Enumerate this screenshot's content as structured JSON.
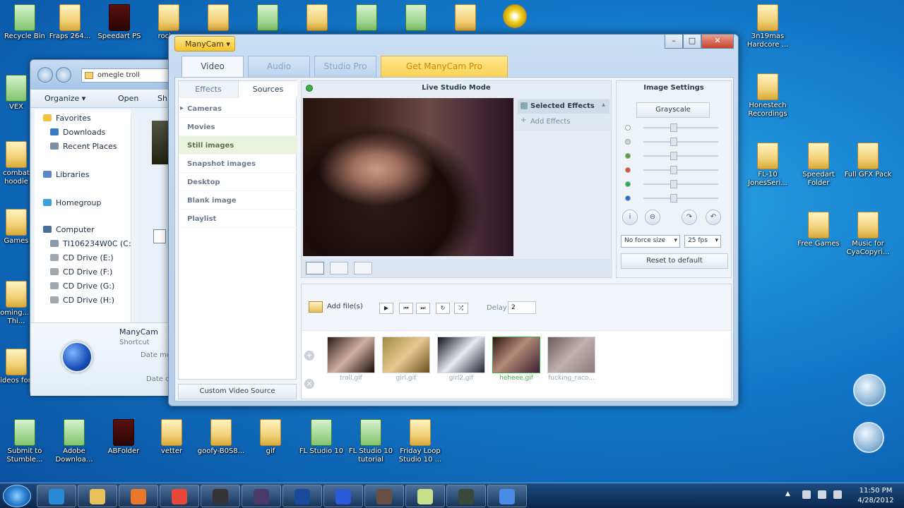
{
  "desktop": {
    "icons_top": [
      {
        "label": "Recycle Bin",
        "kind": "bin"
      },
      {
        "label": "Fraps 264...",
        "kind": "folder"
      },
      {
        "label": "Speedart PS",
        "kind": "dark"
      },
      {
        "label": "rock...",
        "kind": "folder"
      },
      {
        "label": "",
        "kind": "folder"
      },
      {
        "label": "",
        "kind": "app"
      },
      {
        "label": "",
        "kind": "folder"
      },
      {
        "label": "",
        "kind": "app"
      },
      {
        "label": "",
        "kind": "app"
      },
      {
        "label": "",
        "kind": "folder"
      },
      {
        "label": "",
        "kind": "disc"
      }
    ],
    "icons_left": [
      {
        "label": "VEX",
        "kind": "app"
      },
      {
        "label": "combat hoodie",
        "kind": "folder"
      },
      {
        "label": "Games",
        "kind": "folder"
      },
      {
        "label": "Coming... + Thi...",
        "kind": "folder"
      },
      {
        "label": "Videos for...",
        "kind": "folder"
      }
    ],
    "icons_right": [
      {
        "label": "3n19mas Hardcore ...",
        "kind": "folder"
      },
      {
        "label": "Honestech Recordings",
        "kind": "folder"
      },
      {
        "label": "FL-10 JonesSeri...",
        "kind": "folder"
      },
      {
        "label": "Speedart Folder",
        "kind": "folder"
      },
      {
        "label": "Full GFX Pack",
        "kind": "folder"
      },
      {
        "label": "Free Games",
        "kind": "folder"
      },
      {
        "label": "Music for CyaCopyri...",
        "kind": "folder"
      }
    ],
    "icons_bottom": [
      {
        "label": "Submit to Stumble...",
        "kind": "app"
      },
      {
        "label": "Adobe Downloa...",
        "kind": "app"
      },
      {
        "label": "ABFolder",
        "kind": "dark"
      },
      {
        "label": "vetter",
        "kind": "folder"
      },
      {
        "label": "goofy-B0S8...",
        "kind": "folder"
      },
      {
        "label": "gif",
        "kind": "folder"
      },
      {
        "label": "FL Studio 10",
        "kind": "app"
      },
      {
        "label": "FL Studio 10 tutorial",
        "kind": "app"
      },
      {
        "label": "Friday Loop Studio 10 ...",
        "kind": "folder"
      }
    ]
  },
  "explorer": {
    "address": "omegle troll",
    "toolbar": {
      "organize": "Organize ▾",
      "open": "Open",
      "share": "Sh"
    },
    "tree": [
      {
        "label": "Favorites",
        "icon": "star-icon",
        "color": "#f2c23a",
        "indent": 0
      },
      {
        "label": "Downloads",
        "icon": "downloads-icon",
        "color": "#3a79c8",
        "indent": 1
      },
      {
        "label": "Recent Places",
        "icon": "recent-places-icon",
        "color": "#7a8ea8",
        "indent": 1
      },
      {
        "label": "Libraries",
        "icon": "libraries-icon",
        "color": "#5a87c5",
        "indent": 0
      },
      {
        "label": "Homegroup",
        "icon": "homegroup-icon",
        "color": "#3aa0d8",
        "indent": 0
      },
      {
        "label": "Computer",
        "icon": "computer-icon",
        "color": "#4b6f9c",
        "indent": 0
      },
      {
        "label": "TI106234W0C (C:)",
        "icon": "drive-icon",
        "color": "#8899aa",
        "indent": 1
      },
      {
        "label": "CD Drive (E:)",
        "icon": "cd-drive-icon",
        "color": "#a0a8b0",
        "indent": 1
      },
      {
        "label": "CD Drive (F:)",
        "icon": "cd-drive-icon",
        "color": "#a0a8b0",
        "indent": 1
      },
      {
        "label": "CD Drive (G:)",
        "icon": "cd-drive-icon",
        "color": "#a0a8b0",
        "indent": 1
      },
      {
        "label": "CD Drive (H:)",
        "icon": "cd-drive-icon",
        "color": "#a0a8b0",
        "indent": 1
      }
    ],
    "detail": {
      "name": "ManyCam",
      "type": "Shortcut",
      "date_modified": "Date mo",
      "date_created": "Date c"
    }
  },
  "manycam": {
    "menu": "ManyCam ▾",
    "tabs": {
      "video": "Video",
      "audio": "Audio",
      "studio": "Studio Pro",
      "get": "Get ManyCam Pro"
    },
    "source_tabs": {
      "effects": "Effects",
      "sources": "Sources"
    },
    "sources": [
      "Cameras",
      "Movies",
      "Still images",
      "Snapshot images",
      "Desktop",
      "Blank image",
      "Playlist"
    ],
    "sources_caret": "▸",
    "selected_source": 2,
    "custom_source": "Custom Video Source",
    "studio_title": "Live Studio Mode",
    "selected_effects": "Selected Effects",
    "add_effects": "Add Effects",
    "image_settings": {
      "title": "Image Settings",
      "grayscale": "Grayscale",
      "sliders": [
        {
          "icon": "brightness-icon",
          "color": "#ffffff"
        },
        {
          "icon": "contrast-icon",
          "color": "#d0d0d0"
        },
        {
          "icon": "saturation-icon",
          "color": "#5aa03a"
        },
        {
          "icon": "red-channel-icon",
          "color": "#e84a2a"
        },
        {
          "icon": "green-channel-icon",
          "color": "#2ab04a"
        },
        {
          "icon": "blue-channel-icon",
          "color": "#2a6ad8"
        }
      ],
      "force_size": "No force size",
      "fps": "25 fps",
      "reset": "Reset to default"
    },
    "files": {
      "add_files": "Add file(s)",
      "delay_label": "Delay",
      "delay_value": "2",
      "thumbs": [
        {
          "label": "troll.gif",
          "active": false
        },
        {
          "label": "girl.gif",
          "active": false
        },
        {
          "label": "girl2.gif",
          "active": false
        },
        {
          "label": "heheee.gif",
          "active": true
        },
        {
          "label": "fucking_raco...",
          "active": false
        }
      ]
    }
  },
  "taskbar": {
    "time": "11:50 PM",
    "date": "4/28/2012"
  }
}
